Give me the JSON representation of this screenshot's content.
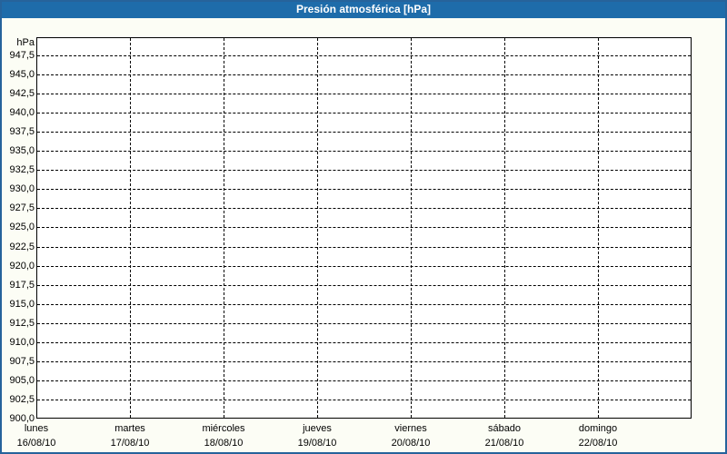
{
  "title": "Presión atmosférica [hPa]",
  "colors": {
    "titlebar_blue": "#1E6CAA",
    "border_blue": "#26639B",
    "page_bg": "#FCFDF5",
    "plot_bg": "#FFFFFF",
    "grid_color": "#000000",
    "axis_text": "#000000",
    "title_text": "#FFFFFF"
  },
  "chart_data": {
    "type": "line",
    "title": "Presión atmosférica [hPa]",
    "y_unit_label": "hPa",
    "ylabel": "hPa",
    "xlabel": "",
    "ylim": [
      900.0,
      950.0
    ],
    "y_tick_step": 2.5,
    "y_tick_values": [
      947.5,
      945.0,
      942.5,
      940.0,
      937.5,
      935.0,
      932.5,
      930.0,
      927.5,
      925.0,
      922.5,
      920.0,
      917.5,
      915.0,
      912.5,
      910.0,
      907.5,
      905.0,
      902.5,
      900.0
    ],
    "y_tick_labels": [
      "947,5",
      "945,0",
      "942,5",
      "940,0",
      "937,5",
      "935,0",
      "932,5",
      "930,0",
      "927,5",
      "925,0",
      "922,5",
      "920,0",
      "917,5",
      "915,0",
      "912,5",
      "910,0",
      "907,5",
      "905,0",
      "902,5",
      "900,0"
    ],
    "x_axis": [
      {
        "day": "lunes",
        "date": "16/08/10"
      },
      {
        "day": "martes",
        "date": "17/08/10"
      },
      {
        "day": "miércoles",
        "date": "18/08/10"
      },
      {
        "day": "jueves",
        "date": "19/08/10"
      },
      {
        "day": "viernes",
        "date": "20/08/10"
      },
      {
        "day": "sábado",
        "date": "21/08/10"
      },
      {
        "day": "domingo",
        "date": "22/08/10"
      }
    ],
    "series": [],
    "grid": {
      "horizontal": "dashed",
      "vertical": "dashed",
      "on": true
    },
    "legend": "none"
  }
}
